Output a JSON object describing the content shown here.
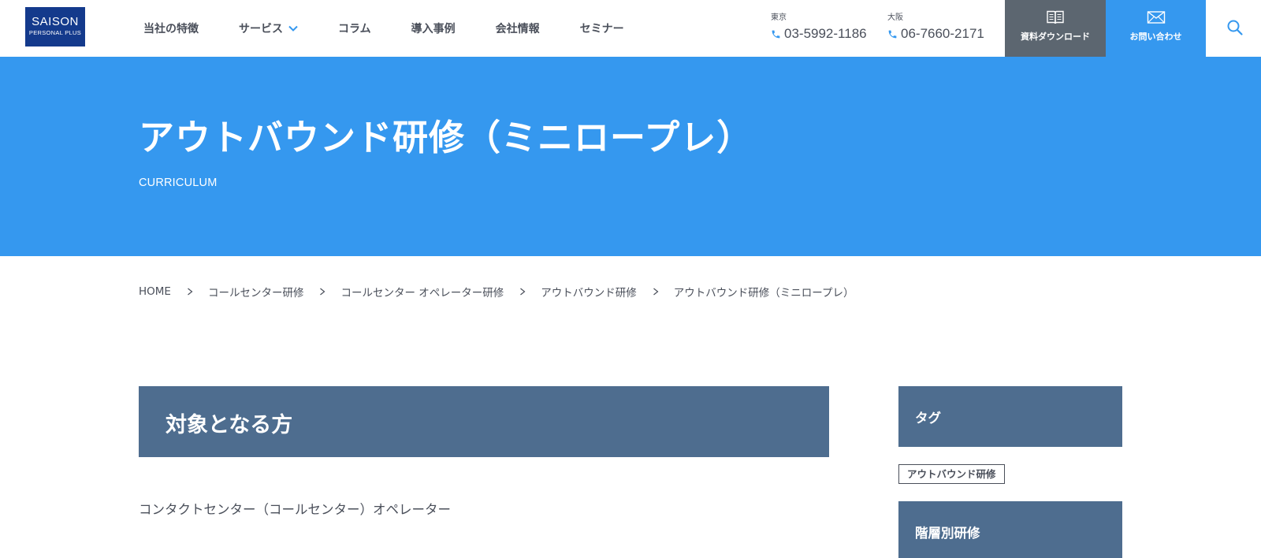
{
  "header": {
    "logo": {
      "main": "SAISON",
      "sub": "PERSONAL PLUS"
    },
    "nav": [
      {
        "label": "当社の特徴"
      },
      {
        "label": "サービス"
      },
      {
        "label": "コラム"
      },
      {
        "label": "導入事例"
      },
      {
        "label": "会社情報"
      },
      {
        "label": "セミナー"
      }
    ],
    "phones": [
      {
        "label": "東京",
        "number": "03-5992-1186"
      },
      {
        "label": "大阪",
        "number": "06-7660-2171"
      }
    ],
    "download_label": "資料ダウンロード",
    "contact_label": "お問い合わせ"
  },
  "hero": {
    "title": "アウトバウンド研修（ミニロープレ）",
    "subtitle": "CURRICULUM"
  },
  "breadcrumb": [
    "HOME",
    "コールセンター研修",
    "コールセンター オペレーター研修",
    "アウトバウンド研修",
    "アウトバウンド研修（ミニロープレ）"
  ],
  "main": {
    "section_title": "対象となる方",
    "body": "コンタクトセンター（コールセンター）オペレーター"
  },
  "sidebar": {
    "tag_title": "タグ",
    "tags": [
      "アウトバウンド研修"
    ],
    "level_title": "階層別研修"
  },
  "colors": {
    "brand_blue": "#3598ef",
    "logo_navy": "#143a8c",
    "download_gray": "#5c6670",
    "section_slate": "#4e6d8f",
    "text": "#4a4f5a"
  },
  "icons": [
    "chevron-down-icon",
    "phone-icon",
    "book-icon",
    "mail-icon",
    "search-icon",
    "chevron-right-icon"
  ]
}
